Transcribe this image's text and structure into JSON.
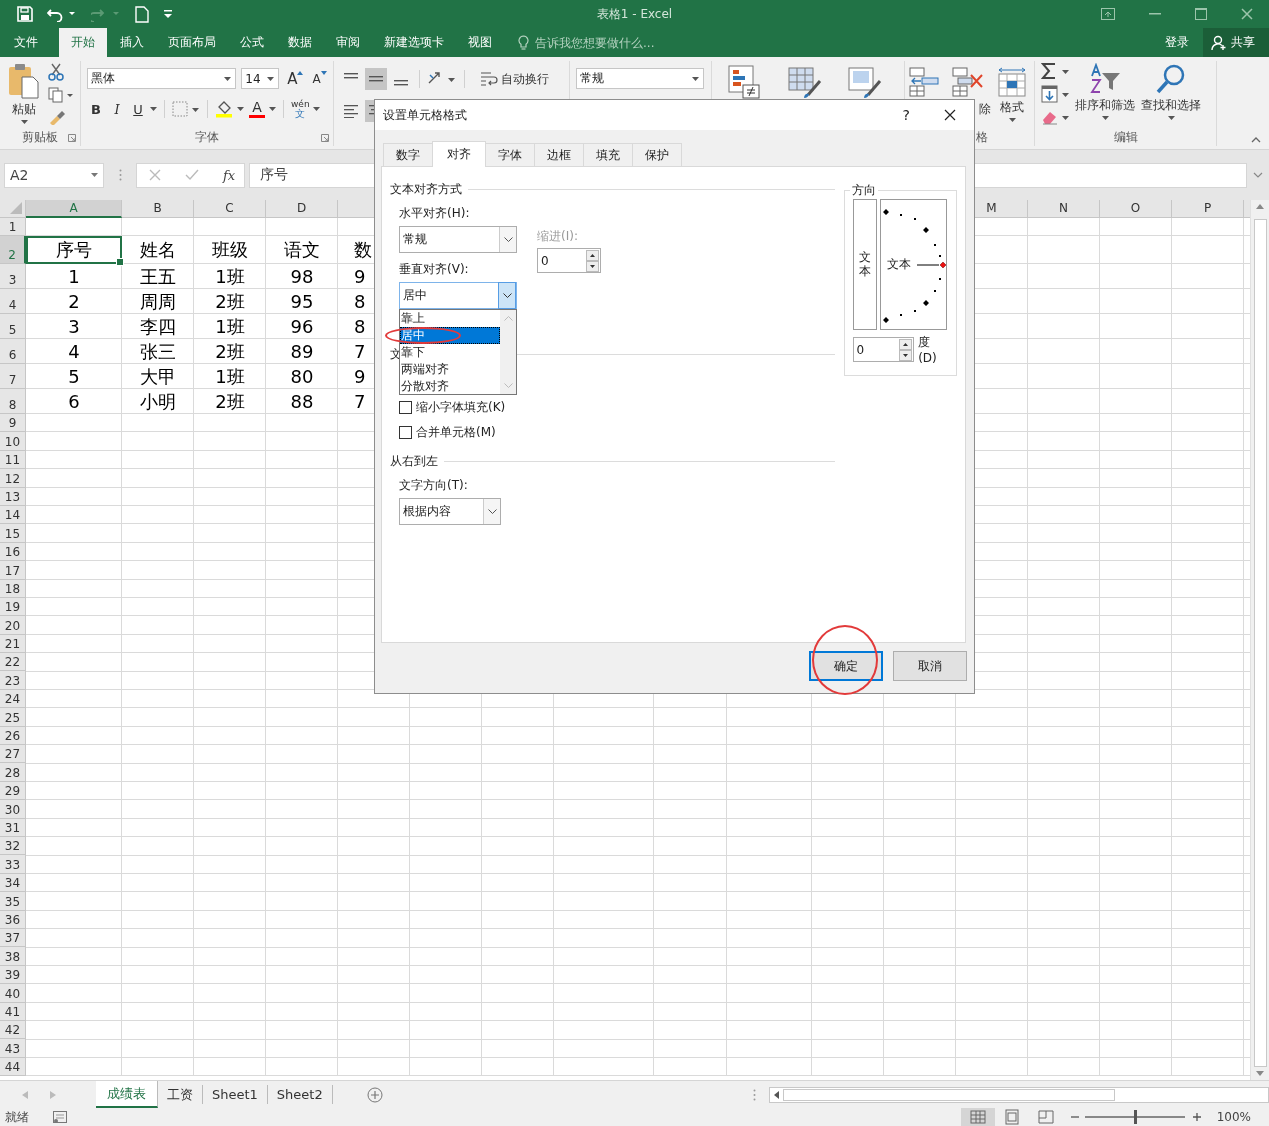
{
  "title_bar": {
    "title": "表格1 - Excel"
  },
  "menu_tabs": [
    {
      "label": "文件",
      "selected": false
    },
    {
      "label": "开始",
      "selected": true
    },
    {
      "label": "插入",
      "selected": false
    },
    {
      "label": "页面布局",
      "selected": false
    },
    {
      "label": "公式",
      "selected": false
    },
    {
      "label": "数据",
      "selected": false
    },
    {
      "label": "审阅",
      "selected": false
    },
    {
      "label": "新建选项卡",
      "selected": false
    },
    {
      "label": "视图",
      "selected": false
    }
  ],
  "tell_me": {
    "placeholder": "告诉我您想要做什么..."
  },
  "sign_in": "登录",
  "share": "共享",
  "ribbon": {
    "clipboard": {
      "paste": "粘贴",
      "label": "剪贴板"
    },
    "font": {
      "name": "黑体",
      "size": "14",
      "grow": "A",
      "shrink": "A",
      "bold": "B",
      "italic": "I",
      "underline": "U",
      "font_color": "A",
      "phonetic": "wén",
      "phonetic_base": "文",
      "label": "字体"
    },
    "alignment": {
      "vertical_align_buttons": [
        {
          "kind": "top",
          "selected": false
        },
        {
          "kind": "middle",
          "selected": true
        },
        {
          "kind": "bottom",
          "selected": false
        }
      ],
      "horizontal_align_buttons": [
        {
          "kind": "left",
          "selected": false
        },
        {
          "kind": "center",
          "selected": true
        }
      ],
      "wrap_text": "自动换行"
    },
    "number": {
      "format": "常规"
    },
    "cells": {
      "delete_label": "除",
      "format": "格式",
      "label": "格"
    },
    "editing": {
      "sort_filter": "排序和筛选",
      "find_select": "查找和选择",
      "label": "编辑"
    }
  },
  "formula_bar": {
    "name_box": "A2",
    "function": "fx",
    "value": "序号"
  },
  "column_headers": [
    {
      "label": "A",
      "selected": true
    },
    {
      "label": "B",
      "selected": false
    },
    {
      "label": "C",
      "selected": false
    },
    {
      "label": "D",
      "selected": false
    },
    {
      "label": "M",
      "selected": false
    },
    {
      "label": "N",
      "selected": false
    },
    {
      "label": "O",
      "selected": false
    },
    {
      "label": "P",
      "selected": false
    }
  ],
  "row_numbers": [
    {
      "label": "1",
      "selected": false
    },
    {
      "label": "2",
      "selected": true
    },
    {
      "label": "3",
      "selected": false
    },
    {
      "label": "4",
      "selected": false
    },
    {
      "label": "5",
      "selected": false
    },
    {
      "label": "6",
      "selected": false
    },
    {
      "label": "7",
      "selected": false
    },
    {
      "label": "8",
      "selected": false
    },
    {
      "label": "9",
      "selected": false
    },
    {
      "label": "10",
      "selected": false
    },
    {
      "label": "11",
      "selected": false
    },
    {
      "label": "12",
      "selected": false
    },
    {
      "label": "13",
      "selected": false
    },
    {
      "label": "14",
      "selected": false
    },
    {
      "label": "15",
      "selected": false
    },
    {
      "label": "16",
      "selected": false
    },
    {
      "label": "17",
      "selected": false
    },
    {
      "label": "18",
      "selected": false
    },
    {
      "label": "19",
      "selected": false
    },
    {
      "label": "20",
      "selected": false
    },
    {
      "label": "21",
      "selected": false
    },
    {
      "label": "22",
      "selected": false
    },
    {
      "label": "23",
      "selected": false
    },
    {
      "label": "24",
      "selected": false
    },
    {
      "label": "25",
      "selected": false
    },
    {
      "label": "26",
      "selected": false
    },
    {
      "label": "27",
      "selected": false
    },
    {
      "label": "28",
      "selected": false
    },
    {
      "label": "29",
      "selected": false
    },
    {
      "label": "30",
      "selected": false
    },
    {
      "label": "31",
      "selected": false
    },
    {
      "label": "32",
      "selected": false
    },
    {
      "label": "33",
      "selected": false
    },
    {
      "label": "34",
      "selected": false
    },
    {
      "label": "35",
      "selected": false
    },
    {
      "label": "36",
      "selected": false
    },
    {
      "label": "37",
      "selected": false
    },
    {
      "label": "38",
      "selected": false
    },
    {
      "label": "39",
      "selected": false
    },
    {
      "label": "40",
      "selected": false
    },
    {
      "label": "41",
      "selected": false
    },
    {
      "label": "42",
      "selected": false
    },
    {
      "label": "43",
      "selected": false
    },
    {
      "label": "44",
      "selected": false
    }
  ],
  "data_rows": [
    {
      "cells": [
        {
          "text": "序号",
          "selected": true
        },
        {
          "text": "姓名",
          "selected": false
        },
        {
          "text": "班级",
          "selected": false
        },
        {
          "text": "语文",
          "selected": false
        },
        {
          "text": "数",
          "selected": false
        }
      ]
    },
    {
      "cells": [
        {
          "text": "1",
          "selected": false
        },
        {
          "text": "王五",
          "selected": false
        },
        {
          "text": "1班",
          "selected": false
        },
        {
          "text": "98",
          "selected": false
        },
        {
          "text": "9",
          "selected": false
        }
      ]
    },
    {
      "cells": [
        {
          "text": "2",
          "selected": false
        },
        {
          "text": "周周",
          "selected": false
        },
        {
          "text": "2班",
          "selected": false
        },
        {
          "text": "95",
          "selected": false
        },
        {
          "text": "8",
          "selected": false
        }
      ]
    },
    {
      "cells": [
        {
          "text": "3",
          "selected": false
        },
        {
          "text": "李四",
          "selected": false
        },
        {
          "text": "1班",
          "selected": false
        },
        {
          "text": "96",
          "selected": false
        },
        {
          "text": "8",
          "selected": false
        }
      ]
    },
    {
      "cells": [
        {
          "text": "4",
          "selected": false
        },
        {
          "text": "张三",
          "selected": false
        },
        {
          "text": "2班",
          "selected": false
        },
        {
          "text": "89",
          "selected": false
        },
        {
          "text": "7",
          "selected": false
        }
      ]
    },
    {
      "cells": [
        {
          "text": "5",
          "selected": false
        },
        {
          "text": "大甲",
          "selected": false
        },
        {
          "text": "1班",
          "selected": false
        },
        {
          "text": "80",
          "selected": false
        },
        {
          "text": "9",
          "selected": false
        }
      ]
    },
    {
      "cells": [
        {
          "text": "6",
          "selected": false
        },
        {
          "text": "小明",
          "selected": false
        },
        {
          "text": "2班",
          "selected": false
        },
        {
          "text": "88",
          "selected": false
        },
        {
          "text": "7",
          "selected": false
        }
      ]
    }
  ],
  "sheet_tabs": [
    {
      "label": "成绩表",
      "selected": true
    },
    {
      "label": "工资",
      "selected": false
    },
    {
      "label": "Sheet1",
      "selected": false
    },
    {
      "label": "Sheet2",
      "selected": false
    }
  ],
  "status": "就绪",
  "zoom": {
    "level": 0.5,
    "reading": "100%"
  },
  "dialog": {
    "title": "设置单元格格式",
    "help": "?",
    "tabs": [
      {
        "label": "数字",
        "selected": false
      },
      {
        "label": "对齐",
        "selected": true
      },
      {
        "label": "字体",
        "selected": false
      },
      {
        "label": "边框",
        "selected": false
      },
      {
        "label": "填充",
        "selected": false
      },
      {
        "label": "保护",
        "selected": false
      }
    ],
    "text_alignment": {
      "legend": "文本对齐方式",
      "horizontal_label": "水平对齐(H):",
      "horizontal_value": "常规",
      "indent_label": "缩进(I):",
      "indent_disabled": true,
      "indent_value": "0",
      "vertical_label": "垂直对齐(V):",
      "vertical_value": "居中",
      "vertical_options": [
        {
          "label": "靠上",
          "selected": false,
          "circled": false
        },
        {
          "label": "居中",
          "selected": true,
          "circled": true
        },
        {
          "label": "靠下",
          "selected": false,
          "circled": false
        },
        {
          "label": "两端对齐",
          "selected": false,
          "circled": false
        },
        {
          "label": "分散对齐",
          "selected": false,
          "circled": false
        }
      ]
    },
    "text_control": {
      "legend": "文",
      "options": [
        {
          "label": "缩小字体填充(K)",
          "checked": false
        },
        {
          "label": "合并单元格(M)",
          "checked": false
        }
      ]
    },
    "right_to_left": {
      "legend": "从右到左",
      "direction_label": "文字方向(T):",
      "direction_value": "根据内容"
    },
    "orientation": {
      "legend": "方向",
      "vertical_text": "文本",
      "dial_text": "文本",
      "degrees": "0",
      "degrees_label": "度(D)"
    },
    "buttons": [
      {
        "label": "确定",
        "default": true,
        "circled": true
      },
      {
        "label": "取消",
        "default": false,
        "circled": false
      }
    ]
  }
}
